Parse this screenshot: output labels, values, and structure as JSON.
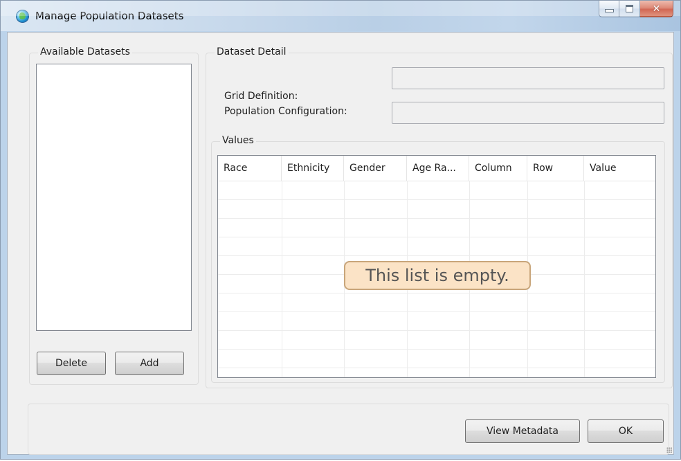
{
  "window": {
    "title": "Manage Population Datasets",
    "app_icon": "globe-icon",
    "close_glyph": "✕"
  },
  "available": {
    "label": "Available Datasets",
    "items": [],
    "delete_label": "Delete",
    "add_label": "Add"
  },
  "detail": {
    "label": "Dataset Detail",
    "grid_definition_label": "Grid Definition:",
    "grid_definition_value": "",
    "population_config_label": "Population Configuration:",
    "population_config_value": ""
  },
  "values": {
    "label": "Values",
    "columns": [
      "Race",
      "Ethnicity",
      "Gender",
      "Age Ra...",
      "Column",
      "Row",
      "Value"
    ],
    "rows": [],
    "empty_message": "This list is empty."
  },
  "footer": {
    "view_metadata_label": "View Metadata",
    "ok_label": "OK"
  },
  "colors": {
    "empty_bg": "#fbe3c6",
    "empty_border": "#c8a57a",
    "close_button": "#c2351b"
  }
}
